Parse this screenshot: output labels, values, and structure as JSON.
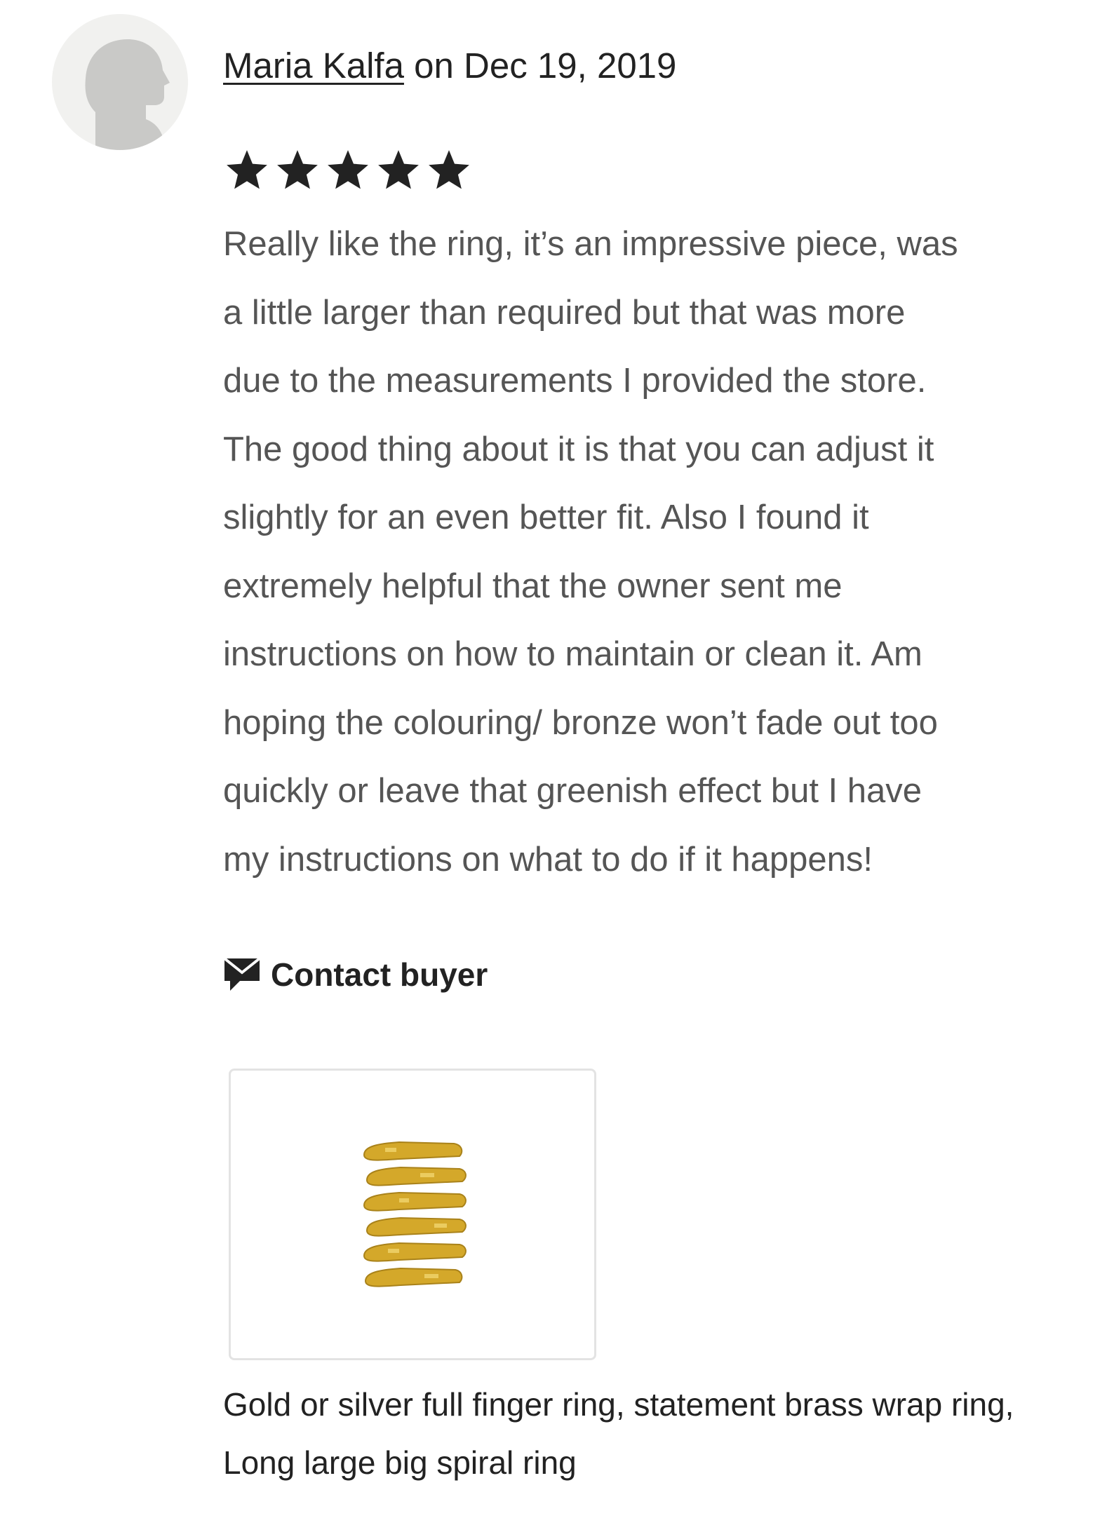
{
  "review": {
    "author": "Maria Kalfa",
    "date_text": " on Dec 19, 2019",
    "rating": 5,
    "rating_max": 5,
    "text_lines": [
      "Really like the ring, it’s an impressive piece, was",
      "a little larger than required but that was more",
      "due to the measurements I provided the store.",
      "The good thing about it is that you can adjust it",
      "slightly for an even better fit. Also I found it",
      "extremely helpful that the owner sent me",
      "instructions on how to maintain or clean it. Am",
      "hoping the colouring/ bronze won’t fade out too",
      "quickly or leave that greenish effect but I have",
      "my instructions on what to do if it happens!"
    ]
  },
  "contact": {
    "label": "Contact buyer",
    "icon": "envelope-icon"
  },
  "product": {
    "image_icon": "spiral-ring-image",
    "title_lines": [
      "Gold or silver full finger ring, statement brass wrap ring,",
      "Long large big spiral ring"
    ]
  },
  "colors": {
    "text_primary": "#222222",
    "text_body": "#555555",
    "star": "#222222",
    "card_border": "#e3e3e3",
    "avatar_bg": "#f1f1ef",
    "avatar_fg": "#c9c9c7",
    "ring_gold": "#d4a82a"
  }
}
